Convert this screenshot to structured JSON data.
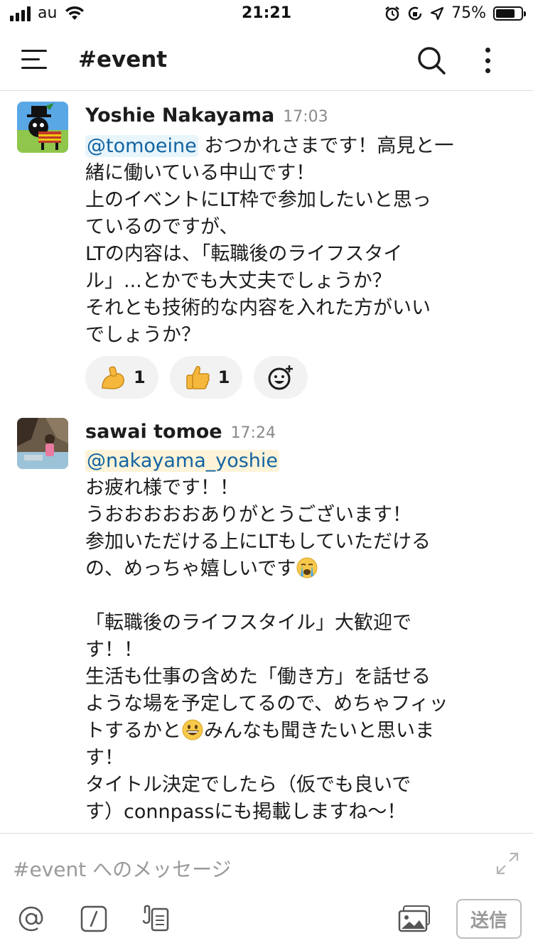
{
  "status_bar": {
    "carrier": "au",
    "time": "21:21",
    "battery_percent": "75%",
    "battery_level": 0.75
  },
  "header": {
    "channel": "#event"
  },
  "messages": [
    {
      "author": "Yoshie Nakayama",
      "time": "17:03",
      "mention": "@tomoeine",
      "lines": [
        "おつかれさまです！高見と一",
        "緒に働いている中山です！",
        "上のイベントにLT枠で参加したいと思っ",
        "ているのですが、",
        "LTの内容は、「転職後のライフスタイ",
        "ル」...とかでも大丈夫でしょうか？",
        "それとも技術的な内容を入れた方がいい",
        "でしょうか？"
      ],
      "reactions": [
        {
          "emoji": "flexed-biceps",
          "count": "1"
        },
        {
          "emoji": "thumbs-up",
          "count": "1"
        }
      ]
    },
    {
      "author": "sawai tomoe",
      "time": "17:24",
      "mention": "@nakayama_yoshie",
      "lines": [
        "お疲れ様です！！",
        "うおおおおおありがとうございます！",
        "参加いただける上にLTもしていただける",
        "の、めっちゃ嬉しいです",
        "",
        "「転職後のライフスタイル」大歓迎で",
        "す！！",
        "生活も仕事の含めた「働き方」を話せる",
        "ような場を予定してるので、めちゃフィッ",
        "トするかと",
        "みんなも聞きたいと思いま",
        "す！",
        "タイトル決定でしたら（仮でも良いで",
        "す）connpassにも掲載しますね〜！"
      ]
    }
  ],
  "composer": {
    "placeholder": "#event へのメッセージ",
    "send_label": "送信"
  },
  "icons": {
    "menu": "hamburger-icon",
    "search": "search-icon",
    "more": "more-vertical-icon",
    "add_reaction": "add-reaction-icon",
    "mention": "at-icon",
    "slash": "slash-command-icon",
    "attach": "attachment-icon",
    "photo": "photo-icon",
    "expand": "expand-icon"
  },
  "colors": {
    "mention_text": "#1264a3",
    "mention_bg": "#e8f5fa",
    "mention_self_bg": "#fdf3d8"
  }
}
